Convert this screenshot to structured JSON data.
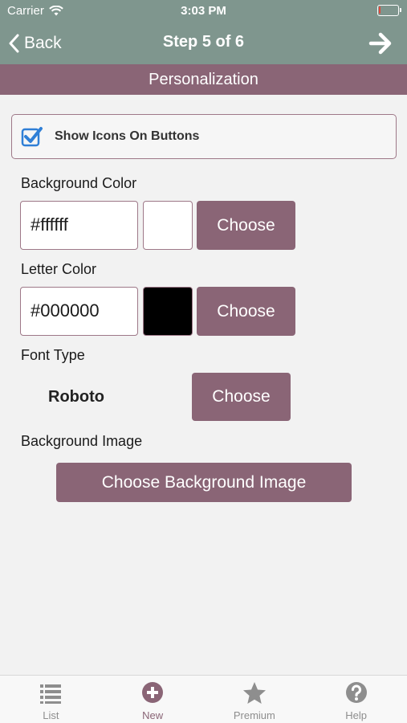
{
  "status_bar": {
    "carrier": "Carrier",
    "time": "3:03 PM",
    "battery_level": 0.08
  },
  "nav": {
    "back_label": "Back",
    "title": "Step 5 of 6"
  },
  "section_title": "Personalization",
  "show_icons": {
    "label": "Show Icons On Buttons",
    "checked": true
  },
  "background_color": {
    "label": "Background Color",
    "value": "#ffffff",
    "swatch": "#ffffff",
    "button": "Choose"
  },
  "letter_color": {
    "label": "Letter Color",
    "value": "#000000",
    "swatch": "#000000",
    "button": "Choose"
  },
  "font_type": {
    "label": "Font Type",
    "value": "Roboto",
    "button": "Choose"
  },
  "background_image": {
    "label": "Background Image",
    "button": "Choose Background Image"
  },
  "tabs": [
    {
      "label": "List",
      "icon": "list-icon"
    },
    {
      "label": "New",
      "icon": "plus-circle-icon",
      "active": true
    },
    {
      "label": "Premium",
      "icon": "star-icon"
    },
    {
      "label": "Help",
      "icon": "help-icon"
    }
  ],
  "colors": {
    "header_green": "#7f968e",
    "accent_mauve": "#8a6576",
    "checkbox_blue": "#2f7fd6",
    "tab_gray": "#8e8e8e"
  }
}
